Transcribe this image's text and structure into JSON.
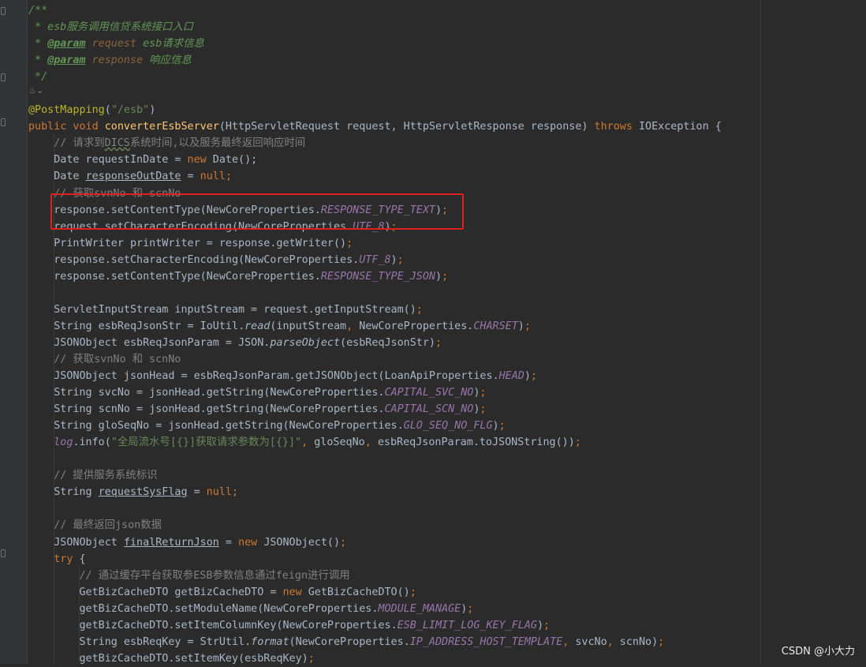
{
  "code_lines": [
    {
      "tokens": [
        {
          "c": "dc",
          "t": "/**"
        }
      ]
    },
    {
      "tokens": [
        {
          "c": "dc",
          "t": " * esb服务调用信贷系统接口入口"
        }
      ]
    },
    {
      "tokens": [
        {
          "c": "dc",
          "t": " * "
        },
        {
          "c": "tag",
          "t": "@param"
        },
        {
          "c": "dc",
          "t": " "
        },
        {
          "c": "prm",
          "t": "request"
        },
        {
          "c": "dc",
          "t": " esb请求信息"
        }
      ]
    },
    {
      "tokens": [
        {
          "c": "dc",
          "t": " * "
        },
        {
          "c": "tag",
          "t": "@param"
        },
        {
          "c": "dc",
          "t": " "
        },
        {
          "c": "prm",
          "t": "response"
        },
        {
          "c": "dc",
          "t": " 响应信息"
        }
      ]
    },
    {
      "tokens": [
        {
          "c": "dc",
          "t": " */"
        }
      ]
    },
    {
      "tokens": [
        {
          "c": "",
          "t": ""
        }
      ]
    },
    {
      "tokens": [
        {
          "c": "an",
          "t": "@PostMapping"
        },
        {
          "c": "",
          "t": "("
        },
        {
          "c": "st",
          "t": "\"/esb\""
        },
        {
          "c": "",
          "t": ")"
        }
      ]
    },
    {
      "tokens": [
        {
          "c": "kw",
          "t": "public void "
        },
        {
          "c": "fn",
          "t": "converterEsbServer"
        },
        {
          "c": "",
          "t": "(HttpServletRequest request, HttpServletResponse response) "
        },
        {
          "c": "kw",
          "t": "throws "
        },
        {
          "c": "",
          "t": "IOException {"
        }
      ]
    },
    {
      "tokens": [
        {
          "c": "",
          "t": "    "
        },
        {
          "c": "cm",
          "t": "// 请求到"
        },
        {
          "c": "cm sq",
          "t": "DICS"
        },
        {
          "c": "cm",
          "t": "系统时间,以及服务最终返回响应时间"
        }
      ]
    },
    {
      "tokens": [
        {
          "c": "",
          "t": "    Date requestInDate = "
        },
        {
          "c": "kw",
          "t": "new "
        },
        {
          "c": "",
          "t": "Date();"
        }
      ]
    },
    {
      "tokens": [
        {
          "c": "",
          "t": "    Date "
        },
        {
          "c": "ul",
          "t": "responseOutDate"
        },
        {
          "c": "",
          "t": " = "
        },
        {
          "c": "kw",
          "t": "null"
        },
        {
          "c": "kw",
          "t": ";"
        }
      ]
    },
    {
      "tokens": [
        {
          "c": "",
          "t": "    "
        },
        {
          "c": "cm",
          "t": "// 获取svnNo 和 scnNo"
        }
      ]
    },
    {
      "tokens": [
        {
          "c": "",
          "t": "    response.setContentType(NewCoreProperties."
        },
        {
          "c": "cn",
          "t": "RESPONSE_TYPE_TEXT"
        },
        {
          "c": "",
          "t": ")"
        },
        {
          "c": "kw",
          "t": ";"
        }
      ]
    },
    {
      "tokens": [
        {
          "c": "",
          "t": "    request.setCharacterEncoding(NewCoreProperties."
        },
        {
          "c": "cn",
          "t": "UTF_8"
        },
        {
          "c": "",
          "t": ")"
        },
        {
          "c": "kw",
          "t": ";"
        }
      ]
    },
    {
      "tokens": [
        {
          "c": "",
          "t": "    PrintWriter printWriter = response.getWriter()"
        },
        {
          "c": "kw",
          "t": ";"
        }
      ]
    },
    {
      "tokens": [
        {
          "c": "",
          "t": "    response.setCharacterEncoding(NewCoreProperties."
        },
        {
          "c": "cn",
          "t": "UTF_8"
        },
        {
          "c": "",
          "t": ")"
        },
        {
          "c": "kw",
          "t": ";"
        }
      ]
    },
    {
      "tokens": [
        {
          "c": "",
          "t": "    response.setContentType(NewCoreProperties."
        },
        {
          "c": "cn",
          "t": "RESPONSE_TYPE_JSON"
        },
        {
          "c": "",
          "t": ")"
        },
        {
          "c": "kw",
          "t": ";"
        }
      ]
    },
    {
      "tokens": [
        {
          "c": "",
          "t": ""
        }
      ]
    },
    {
      "tokens": [
        {
          "c": "",
          "t": "    ServletInputStream inputStream = request.getInputStream()"
        },
        {
          "c": "kw",
          "t": ";"
        }
      ]
    },
    {
      "tokens": [
        {
          "c": "",
          "t": "    String esbReqJsonStr = IoUtil."
        },
        {
          "c": "it",
          "t": "read"
        },
        {
          "c": "",
          "t": "(inputStream"
        },
        {
          "c": "kw",
          "t": ", "
        },
        {
          "c": "",
          "t": "NewCoreProperties."
        },
        {
          "c": "cn",
          "t": "CHARSET"
        },
        {
          "c": "",
          "t": ")"
        },
        {
          "c": "kw",
          "t": ";"
        }
      ]
    },
    {
      "tokens": [
        {
          "c": "",
          "t": "    JSONObject esbReqJsonParam = JSON."
        },
        {
          "c": "it",
          "t": "parseObject"
        },
        {
          "c": "",
          "t": "(esbReqJsonStr)"
        },
        {
          "c": "kw",
          "t": ";"
        }
      ]
    },
    {
      "tokens": [
        {
          "c": "",
          "t": "    "
        },
        {
          "c": "cm",
          "t": "// 获取svnNo 和 scnNo"
        }
      ]
    },
    {
      "tokens": [
        {
          "c": "",
          "t": "    JSONObject jsonHead = esbReqJsonParam.getJSONObject(LoanApiProperties."
        },
        {
          "c": "cn",
          "t": "HEAD"
        },
        {
          "c": "",
          "t": ")"
        },
        {
          "c": "kw",
          "t": ";"
        }
      ]
    },
    {
      "tokens": [
        {
          "c": "",
          "t": "    String svcNo = jsonHead.getString(NewCoreProperties."
        },
        {
          "c": "cn",
          "t": "CAPITAL_SVC_NO"
        },
        {
          "c": "",
          "t": ")"
        },
        {
          "c": "kw",
          "t": ";"
        }
      ]
    },
    {
      "tokens": [
        {
          "c": "",
          "t": "    String scnNo = jsonHead.getString(NewCoreProperties."
        },
        {
          "c": "cn",
          "t": "CAPITAL_SCN_NO"
        },
        {
          "c": "",
          "t": ")"
        },
        {
          "c": "kw",
          "t": ";"
        }
      ]
    },
    {
      "tokens": [
        {
          "c": "",
          "t": "    String gloSeqNo = jsonHead.getString(NewCoreProperties."
        },
        {
          "c": "cn",
          "t": "GLO_SEQ_NO_FLG"
        },
        {
          "c": "",
          "t": ")"
        },
        {
          "c": "kw",
          "t": ";"
        }
      ]
    },
    {
      "tokens": [
        {
          "c": "",
          "t": "    "
        },
        {
          "c": "fd it",
          "t": "log"
        },
        {
          "c": "",
          "t": ".info("
        },
        {
          "c": "st",
          "t": "\"全局流水号[{}]获取请求参数为[{}]\""
        },
        {
          "c": "kw",
          "t": ", "
        },
        {
          "c": "",
          "t": "gloSeqNo"
        },
        {
          "c": "kw",
          "t": ", "
        },
        {
          "c": "",
          "t": "esbReqJsonParam.toJSONString())"
        },
        {
          "c": "kw",
          "t": ";"
        }
      ]
    },
    {
      "tokens": [
        {
          "c": "",
          "t": ""
        }
      ]
    },
    {
      "tokens": [
        {
          "c": "",
          "t": "    "
        },
        {
          "c": "cm",
          "t": "// 提供服务系统标识"
        }
      ]
    },
    {
      "tokens": [
        {
          "c": "",
          "t": "    String "
        },
        {
          "c": "ul",
          "t": "requestSysFlag"
        },
        {
          "c": "",
          "t": " = "
        },
        {
          "c": "kw",
          "t": "null;"
        }
      ]
    },
    {
      "tokens": [
        {
          "c": "",
          "t": ""
        }
      ]
    },
    {
      "tokens": [
        {
          "c": "",
          "t": "    "
        },
        {
          "c": "cm",
          "t": "// 最终返回json数据"
        }
      ]
    },
    {
      "tokens": [
        {
          "c": "",
          "t": "    JSONObject "
        },
        {
          "c": "ul",
          "t": "finalReturnJson"
        },
        {
          "c": "",
          "t": " = "
        },
        {
          "c": "kw",
          "t": "new "
        },
        {
          "c": "",
          "t": "JSONObject()"
        },
        {
          "c": "kw",
          "t": ";"
        }
      ]
    },
    {
      "tokens": [
        {
          "c": "",
          "t": "    "
        },
        {
          "c": "kw",
          "t": "try "
        },
        {
          "c": "",
          "t": "{"
        }
      ]
    },
    {
      "tokens": [
        {
          "c": "",
          "t": "        "
        },
        {
          "c": "cm",
          "t": "// 通过缓存平台获取参ESB参数信息通过feign进行调用"
        }
      ]
    },
    {
      "tokens": [
        {
          "c": "",
          "t": "        GetBizCacheDTO getBizCacheDTO = "
        },
        {
          "c": "kw",
          "t": "new "
        },
        {
          "c": "",
          "t": "GetBizCacheDTO()"
        },
        {
          "c": "kw",
          "t": ";"
        }
      ]
    },
    {
      "tokens": [
        {
          "c": "",
          "t": "        getBizCacheDTO.setModuleName(NewCoreProperties."
        },
        {
          "c": "cn",
          "t": "MODULE_MANAGE"
        },
        {
          "c": "",
          "t": ")"
        },
        {
          "c": "kw",
          "t": ";"
        }
      ]
    },
    {
      "tokens": [
        {
          "c": "",
          "t": "        getBizCacheDTO.setItemColumnKey(NewCoreProperties."
        },
        {
          "c": "cn",
          "t": "ESB_LIMIT_LOG_KEY_FLAG"
        },
        {
          "c": "",
          "t": ")"
        },
        {
          "c": "kw",
          "t": ";"
        }
      ]
    },
    {
      "tokens": [
        {
          "c": "",
          "t": "        String esbReqKey = StrUtil."
        },
        {
          "c": "it",
          "t": "format"
        },
        {
          "c": "",
          "t": "(NewCoreProperties."
        },
        {
          "c": "cn",
          "t": "IP_ADDRESS_HOST_TEMPLATE"
        },
        {
          "c": "kw",
          "t": ", "
        },
        {
          "c": "",
          "t": "svcNo"
        },
        {
          "c": "kw",
          "t": ", "
        },
        {
          "c": "",
          "t": "scnNo)"
        },
        {
          "c": "kw",
          "t": ";"
        }
      ]
    },
    {
      "tokens": [
        {
          "c": "",
          "t": "        getBizCacheDTO.setItemKey(esbReqKey)"
        },
        {
          "c": "kw",
          "t": ";"
        }
      ]
    }
  ],
  "inlay_hint": "♨⌄",
  "watermark": "CSDN @小大力"
}
